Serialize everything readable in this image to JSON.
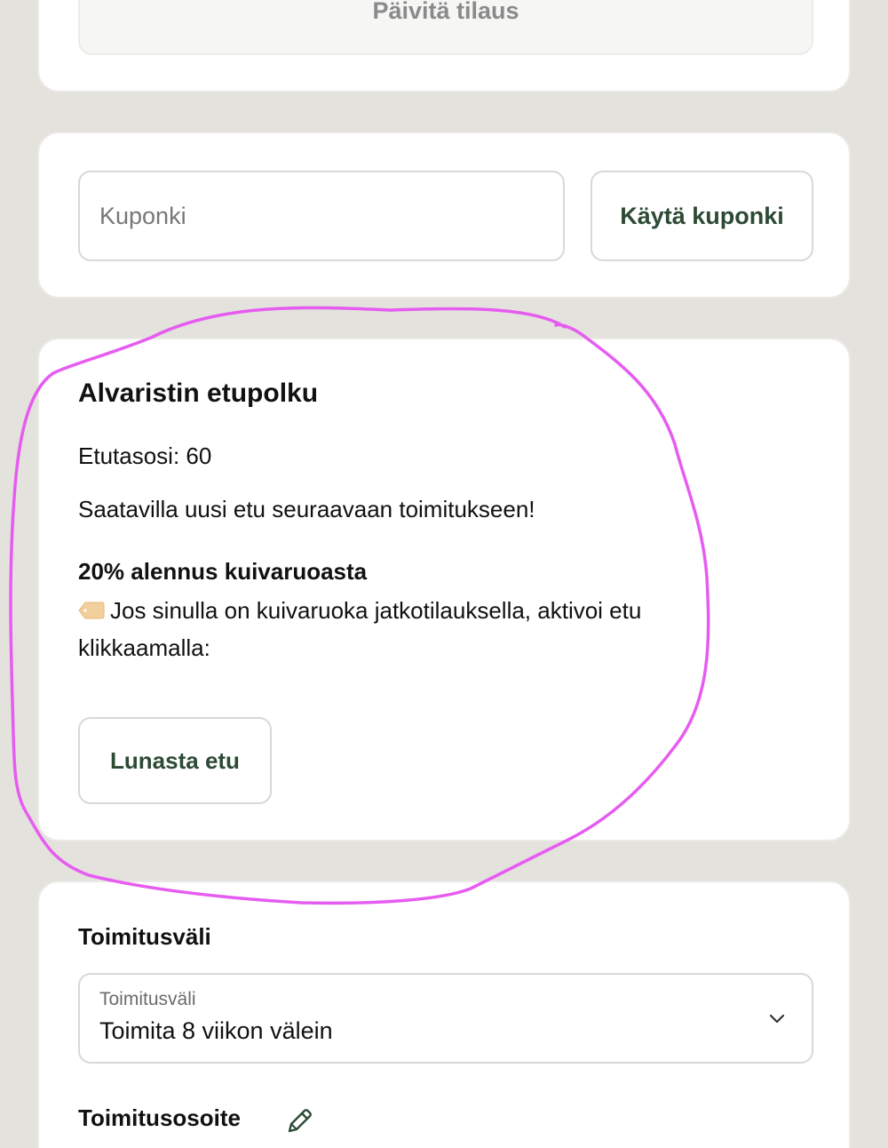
{
  "update_card": {
    "button_label": "Päivitä tilaus"
  },
  "coupon": {
    "placeholder": "Kuponki",
    "apply_label": "Käytä kuponki"
  },
  "perks": {
    "title": "Alvaristin etupolku",
    "level_text": "Etutasosi: 60",
    "available_text": "Saatavilla uusi etu seuraavaan toimitukseen!",
    "perk_name": "20% alennus kuivaruoasta",
    "perk_description": "Jos sinulla on kuivaruoka jatkotilauksella, aktivoi etu klikkaamalla:",
    "perk_icon": "label-tag-icon",
    "redeem_label": "Lunasta etu"
  },
  "delivery": {
    "interval_title": "Toimitusväli",
    "select_label": "Toimitusväli",
    "select_value": "Toimita 8 viikon välein",
    "address_title": "Toimitusosoite",
    "edit_icon": "pencil-icon"
  },
  "colors": {
    "accent_green": "#2c4a34",
    "annotation_magenta": "#e65cf0",
    "background": "#e4e2dd"
  }
}
